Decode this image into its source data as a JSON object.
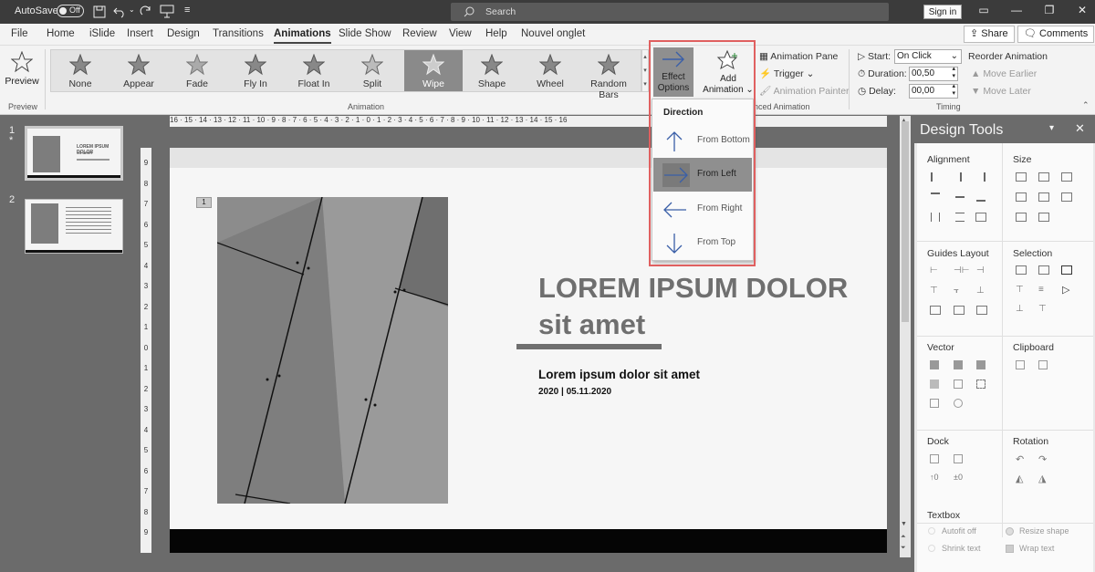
{
  "titlebar": {
    "autosave": "AutoSave",
    "toggle": "Off",
    "search_placeholder": "Search",
    "signin": "Sign in"
  },
  "menu": {
    "items": [
      "File",
      "Home",
      "iSlide",
      "Insert",
      "Design",
      "Transitions",
      "Animations",
      "Slide Show",
      "Review",
      "View",
      "Help",
      "Nouvel onglet"
    ],
    "active": "Animations",
    "share": "Share",
    "comments": "Comments"
  },
  "ribbon": {
    "preview": "Preview",
    "preview_group": "Preview",
    "animations": [
      "None",
      "Appear",
      "Fade",
      "Fly In",
      "Float In",
      "Split",
      "Wipe",
      "Shape",
      "Wheel",
      "Random Bars"
    ],
    "selected_animation": "Wipe",
    "animation_group": "Animation",
    "effect_options": "Effect\nOptions",
    "effect_options_l1": "Effect",
    "effect_options_l2": "Options",
    "add_animation_l1": "Add",
    "add_animation_l2": "Animation",
    "animation_pane": "Animation Pane",
    "trigger": "Trigger",
    "animation_painter": "Animation Painter",
    "advanced_group": "nced Animation",
    "start_label": "Start:",
    "start_value": "On Click",
    "duration_label": "Duration:",
    "duration_value": "00,50",
    "delay_label": "Delay:",
    "delay_value": "00,00",
    "timing_group": "Timing",
    "reorder": "Reorder Animation",
    "move_earlier": "Move Earlier",
    "move_later": "Move Later"
  },
  "dropdown": {
    "heading": "Direction",
    "items": [
      "From Bottom",
      "From Left",
      "From Right",
      "From Top"
    ],
    "selected": "From Left"
  },
  "thumbnails": [
    {
      "num": "1",
      "marker": "*",
      "title": "LOREM IPSUM DOLOR",
      "sub": "sit amet"
    },
    {
      "num": "2"
    }
  ],
  "slide": {
    "badge": "1",
    "title": "LOREM IPSUM DOLOR sit amet",
    "title_l1": "LOREM IPSUM DOLOR",
    "title_l2": "sit amet",
    "subtitle": "Lorem ipsum dolor sit amet",
    "date_line": "2020 | 05.11.2020"
  },
  "ruler": {
    "top": "16 · 15 · 14 · 13 · 12 · 11 · 10 · 9 · 8 · 7 · 6 · 5 · 4 · 3 · 2 · 1 · 0 · 1 · 2 · 3 · 4 · 5 · 6 · 7 · 8 · 9 · 10 · 11 · 12 · 13 · 14 · 15 · 16",
    "left": [
      "9",
      "8",
      "7",
      "6",
      "5",
      "4",
      "3",
      "2",
      "1",
      "0",
      "1",
      "2",
      "3",
      "4",
      "5",
      "6",
      "7",
      "8",
      "9"
    ]
  },
  "design_tools": {
    "title": "Design Tools",
    "sections": [
      "Alignment",
      "Size",
      "Guides Layout",
      "Selection",
      "Vector",
      "Clipboard",
      "Dock",
      "Rotation",
      "Textbox"
    ],
    "autofit": "Autofit off",
    "resize": "Resize shape",
    "shrink": "Shrink text",
    "wrap": "Wrap text"
  }
}
